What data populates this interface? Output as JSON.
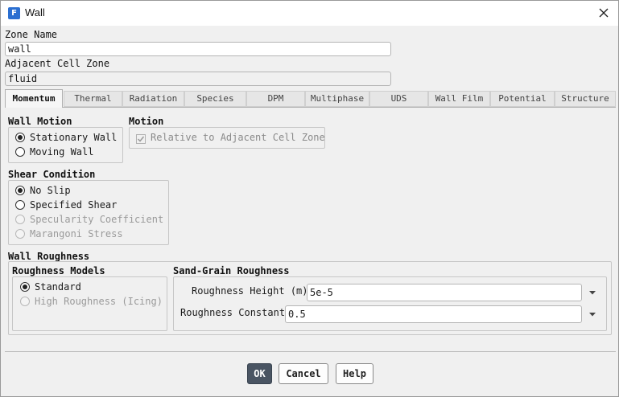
{
  "window": {
    "app_icon_letter": "F",
    "title": "Wall"
  },
  "zone_name": {
    "label": "Zone Name",
    "value": "wall"
  },
  "adjacent_cell_zone": {
    "label": "Adjacent Cell Zone",
    "value": "fluid"
  },
  "tabs": [
    {
      "label": "Momentum",
      "active": true
    },
    {
      "label": "Thermal"
    },
    {
      "label": "Radiation"
    },
    {
      "label": "Species"
    },
    {
      "label": "DPM"
    },
    {
      "label": "Multiphase"
    },
    {
      "label": "UDS"
    },
    {
      "label": "Wall Film"
    },
    {
      "label": "Potential"
    },
    {
      "label": "Structure"
    }
  ],
  "wall_motion": {
    "title": "Wall Motion",
    "options": [
      {
        "label": "Stationary Wall",
        "checked": true
      },
      {
        "label": "Moving Wall"
      }
    ]
  },
  "motion": {
    "title": "Motion",
    "relative_label": "Relative to Adjacent Cell Zone"
  },
  "shear_condition": {
    "title": "Shear Condition",
    "options": [
      {
        "label": "No Slip",
        "checked": true
      },
      {
        "label": "Specified Shear"
      },
      {
        "label": "Specularity Coefficient",
        "disabled": true
      },
      {
        "label": "Marangoni Stress",
        "disabled": true
      }
    ]
  },
  "wall_roughness": {
    "title": "Wall Roughness",
    "models_title": "Roughness Models",
    "models": [
      {
        "label": "Standard",
        "checked": true
      },
      {
        "label": "High Roughness (Icing)",
        "disabled": true
      }
    ],
    "sand_grain_title": "Sand-Grain Roughness",
    "height_label": "Roughness Height (m)",
    "height_value": "5e-5",
    "constant_label": "Roughness Constant",
    "constant_value": "0.5"
  },
  "buttons": {
    "ok": "OK",
    "cancel": "Cancel",
    "help": "Help"
  }
}
